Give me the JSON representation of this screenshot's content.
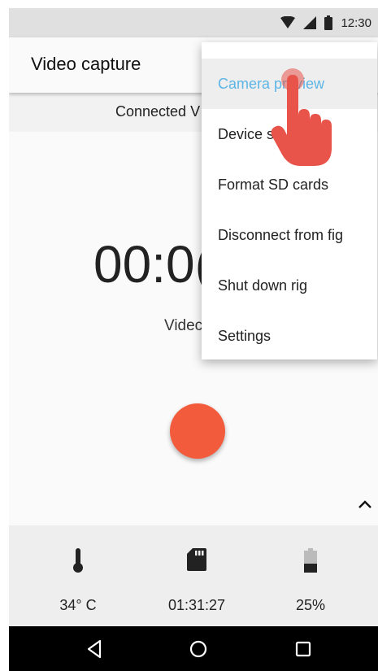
{
  "status_bar": {
    "time": "12:30",
    "icons": [
      "wifi-icon",
      "signal-icon",
      "battery-icon"
    ]
  },
  "app_bar": {
    "title": "Video capture"
  },
  "connection": {
    "text": "Connected V"
  },
  "main": {
    "timer": "00:0(",
    "mode_label": "Videc"
  },
  "menu": {
    "items": [
      {
        "label": "Camera preview",
        "active": true
      },
      {
        "label": "Device st"
      },
      {
        "label": "Format SD cards"
      },
      {
        "label": "Disconnect from fig"
      },
      {
        "label": "Shut down rig"
      },
      {
        "label": "Settings"
      }
    ]
  },
  "stats": {
    "temperature": "34° C",
    "recording_time": "01:31:27",
    "battery": "25%"
  },
  "colors": {
    "record": "#f25c3c",
    "accent": "#5db5e6",
    "hand": "#e8544a"
  }
}
